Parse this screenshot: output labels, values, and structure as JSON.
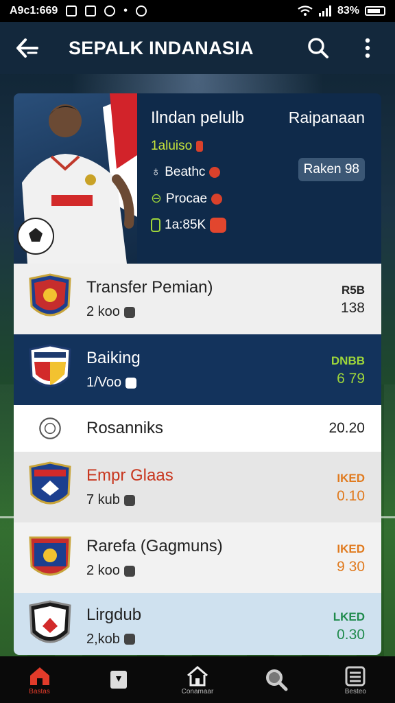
{
  "status_bar": {
    "time": "A9c1:669",
    "battery": "83%"
  },
  "app_bar": {
    "title": "SEPALK INDANASIA"
  },
  "hero": {
    "title": "Ilndan pelulb",
    "side_label": "Raipanaan",
    "stats": [
      {
        "label": "1aluiso",
        "color": "#c9e63b",
        "dot": "#d9412b"
      },
      {
        "label": "Beathc",
        "color": "#ffffff",
        "dot": "#d9412b"
      },
      {
        "label": "Procae",
        "color": "#ffffff",
        "dot": "#d9412b"
      },
      {
        "label": "1a:85K",
        "color": "#ffffff",
        "dot": "#e2462e"
      }
    ],
    "rank_chip": "Raken 98"
  },
  "rows": [
    {
      "name": "Transfer Pemian)",
      "sub": "2 koo",
      "val_top": "R5B",
      "val": "138"
    },
    {
      "name": "Baiking",
      "sub": "1/Voo",
      "val_top": "DNBB",
      "val": "6 79"
    },
    {
      "name": "Rosanniks",
      "sub": "",
      "val_top": "",
      "val": "20.20"
    },
    {
      "name": "Empr Glaas",
      "sub": "7 kub",
      "val_top": "IKED",
      "val": "0.10"
    },
    {
      "name": "Rarefa (Gagmuns)",
      "sub": "2 koo",
      "val_top": "IKED",
      "val": "9 30"
    },
    {
      "name": "Lirgdub",
      "sub": "2,kob",
      "val_top": "LKED",
      "val": "0.30"
    }
  ],
  "colors": {
    "accent_green": "#9ed63a",
    "accent_orange": "#e07a1e",
    "nav_active": "#e23b2a"
  },
  "bottom_nav": [
    {
      "label": "Bastas",
      "icon": "home-icon"
    },
    {
      "label": "",
      "icon": "tag-icon"
    },
    {
      "label": "Conamaar",
      "icon": "house-outline-icon"
    },
    {
      "label": "",
      "icon": "search-icon"
    },
    {
      "label": "Besteo",
      "icon": "menu-icon"
    }
  ]
}
